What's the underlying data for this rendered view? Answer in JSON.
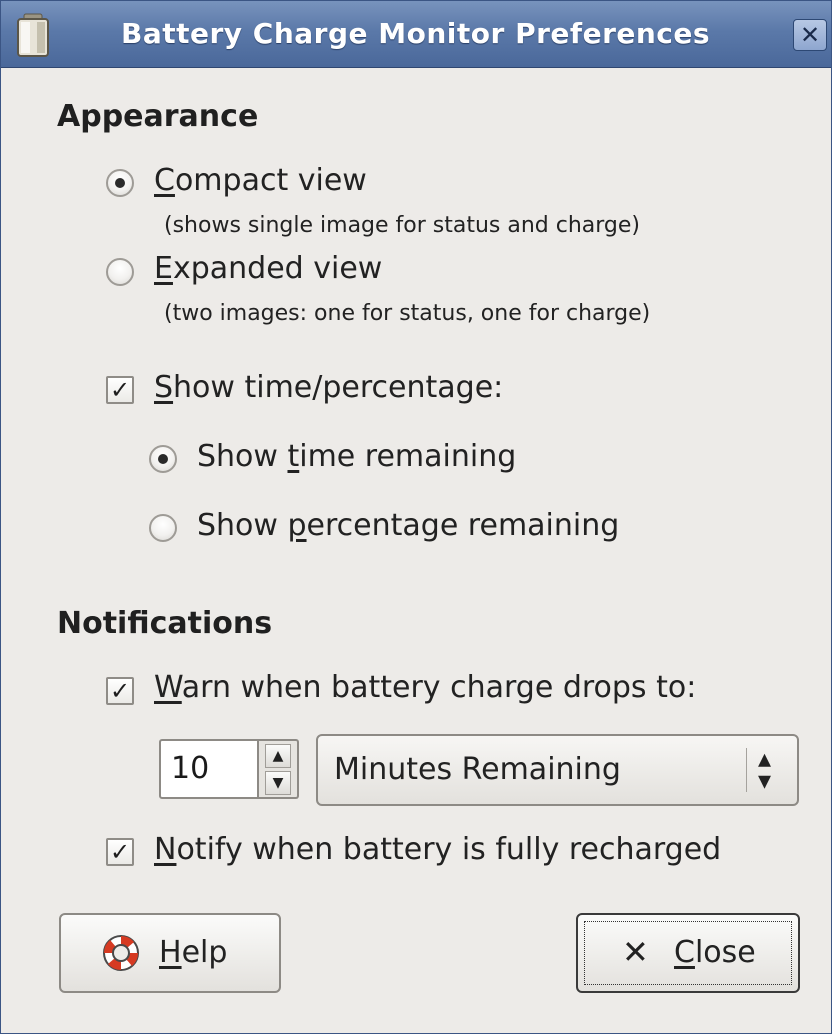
{
  "window": {
    "title": "Battery Charge Monitor Preferences",
    "app_icon": "battery-icon",
    "close_icon": "close-icon"
  },
  "appearance": {
    "heading": "Appearance",
    "compact": {
      "mnemonic": "C",
      "rest": "ompact view",
      "description": "(shows single image for status and charge)",
      "selected": true
    },
    "expanded": {
      "mnemonic": "E",
      "rest": "xpanded view",
      "description": "(two images: one for status, one for charge)",
      "selected": false
    },
    "show_time_percentage": {
      "mnemonic": "S",
      "rest": "how time/percentage:",
      "checked": true
    },
    "show_time_remaining": {
      "before": "Show ",
      "mnemonic": "t",
      "after": "ime remaining",
      "selected": true
    },
    "show_percentage_remaining": {
      "before": "Show ",
      "mnemonic": "p",
      "after": "ercentage remaining",
      "selected": false
    }
  },
  "notifications": {
    "heading": "Notifications",
    "warn": {
      "mnemonic": "W",
      "rest": "arn when battery charge drops to:",
      "checked": true
    },
    "threshold_value": "10",
    "threshold_unit": "Minutes Remaining",
    "notify": {
      "mnemonic": "N",
      "rest": "otify when battery is fully recharged",
      "checked": true
    }
  },
  "buttons": {
    "help": {
      "mnemonic": "H",
      "rest": "elp",
      "icon": "lifebuoy-icon"
    },
    "close": {
      "mnemonic": "C",
      "rest": "lose",
      "icon": "close-icon"
    }
  }
}
